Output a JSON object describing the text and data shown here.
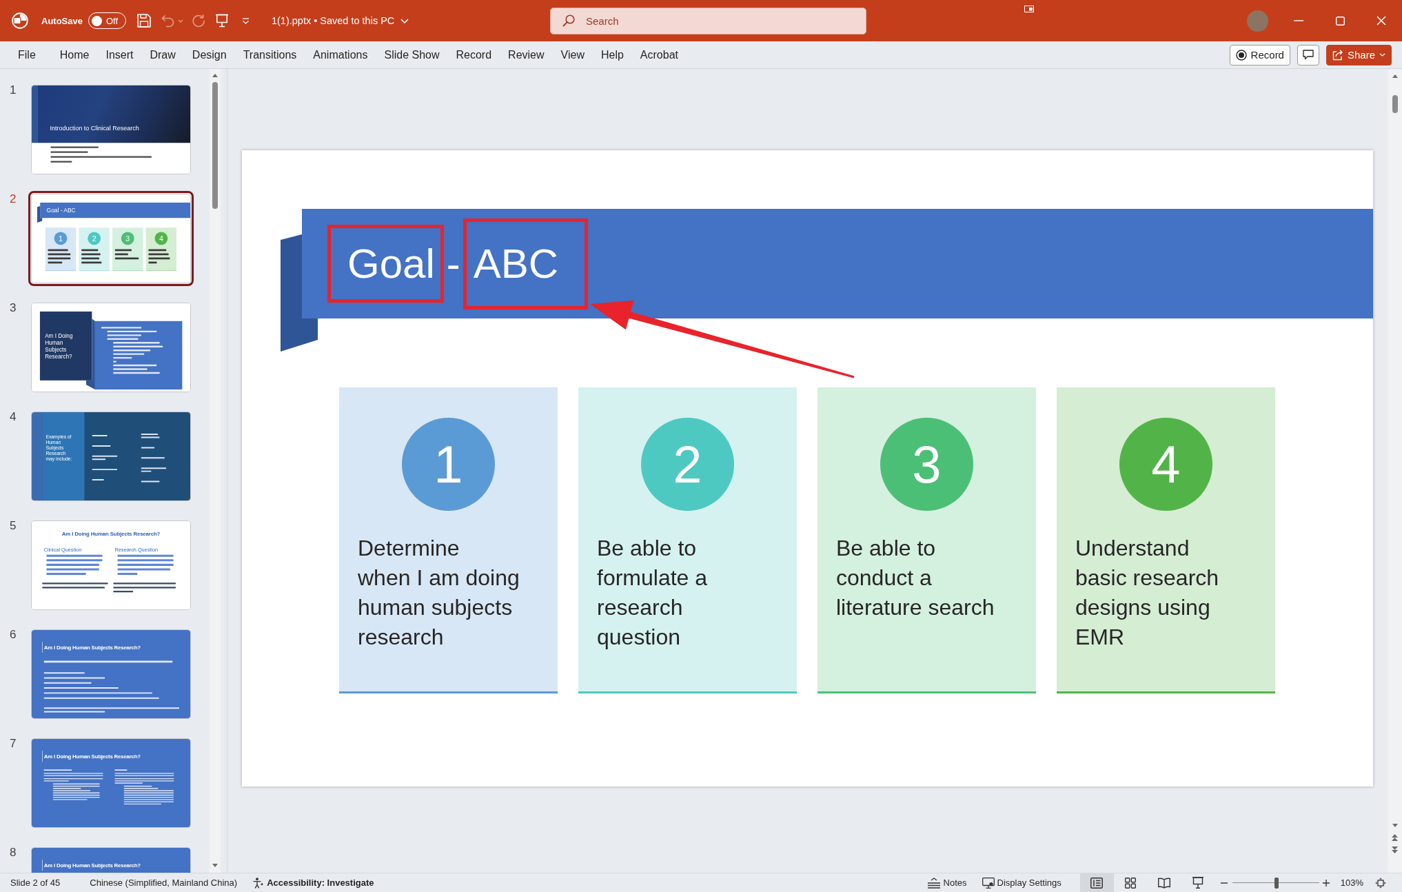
{
  "title_bar": {
    "autosave": {
      "label": "AutoSave",
      "on": false,
      "state_text": "Off"
    },
    "quick_access": [
      {
        "kind": "save",
        "disabled": false
      },
      {
        "kind": "undo",
        "disabled": true
      },
      {
        "kind": "redo",
        "disabled": true
      },
      {
        "kind": "present",
        "disabled": false
      }
    ],
    "document": "1(1).pptx • Saved to this PC",
    "search": {
      "placeholder": "Search"
    }
  },
  "ribbon_tabs": [
    {
      "label": "File",
      "selected": false
    },
    {
      "label": "Home",
      "selected": false
    },
    {
      "label": "Insert",
      "selected": false
    },
    {
      "label": "Draw",
      "selected": false
    },
    {
      "label": "Design",
      "selected": false
    },
    {
      "label": "Transitions",
      "selected": false
    },
    {
      "label": "Animations",
      "selected": false
    },
    {
      "label": "Slide Show",
      "selected": false
    },
    {
      "label": "Record",
      "selected": false
    },
    {
      "label": "Review",
      "selected": false
    },
    {
      "label": "View",
      "selected": false
    },
    {
      "label": "Help",
      "selected": false
    },
    {
      "label": "Acrobat",
      "selected": false
    }
  ],
  "ribbon_actions": {
    "record": "Record",
    "share": "Share"
  },
  "thumbnails": [
    {
      "number": "1",
      "selected": false,
      "slide": {
        "kind": "title",
        "title": "Introduction to Clinical Research"
      }
    },
    {
      "number": "2",
      "selected": true,
      "slide": {
        "kind": "goal",
        "title": "Goal - ABC",
        "cards": [
          {
            "number": "1",
            "color": "#5b9bd5"
          },
          {
            "number": "2",
            "color": "#4ec9c1"
          },
          {
            "number": "3",
            "color": "#4cbf77"
          },
          {
            "number": "4",
            "color": "#52b448"
          }
        ]
      }
    },
    {
      "number": "3",
      "selected": false,
      "slide": {
        "kind": "section",
        "title": "Am I Doing Human Subjects Research?"
      }
    },
    {
      "number": "4",
      "selected": false,
      "slide": {
        "kind": "examples",
        "title": "Examples of Human Subjects Research may include:"
      }
    },
    {
      "number": "5",
      "selected": false,
      "slide": {
        "kind": "two_column",
        "title": "Am I Doing Human Subjects Research?",
        "columns": [
          {
            "heading": "Clinical Question"
          },
          {
            "heading": "Research Question"
          }
        ]
      }
    },
    {
      "number": "6",
      "selected": false,
      "slide": {
        "kind": "list",
        "title": "Am I Doing Human Subjects Research?"
      }
    },
    {
      "number": "7",
      "selected": false,
      "slide": {
        "kind": "comparison",
        "title": "Am I Doing Human Subjects Research?"
      }
    },
    {
      "number": "8",
      "selected": false,
      "slide": {
        "kind": "title_only",
        "title": "Am I Doing Human Subjects Research?"
      }
    }
  ],
  "slide": {
    "title_parts": [
      {
        "text": "Goal",
        "highlighted": true
      },
      {
        "text": "-",
        "highlighted": false
      },
      {
        "text": "ABC",
        "highlighted": true
      }
    ],
    "cards": [
      {
        "number": "1",
        "text": "Determine\nwhen I am doing\nhuman subjects\nresearch",
        "color": "#5b9bd5"
      },
      {
        "number": "2",
        "text": "Be able to\nformulate a\nresearch\nquestion",
        "color": "#4ec9c1"
      },
      {
        "number": "3",
        "text": "Be able to\nconduct a\nliterature search",
        "color": "#4cbf77"
      },
      {
        "number": "4",
        "text": "Understand\nbasic research\ndesigns using\nEMR",
        "color": "#52b448"
      }
    ]
  },
  "status_bar": {
    "slide_info": "Slide 2 of 45",
    "language": "Chinese (Simplified, Mainland China)",
    "accessibility": "Accessibility: Investigate",
    "notes": "Notes",
    "display_settings": "Display Settings",
    "views": [
      {
        "kind": "normal",
        "selected": true
      },
      {
        "kind": "sorter",
        "selected": false
      },
      {
        "kind": "reading",
        "selected": false
      },
      {
        "kind": "slideshow",
        "selected": false
      }
    ],
    "zoom": {
      "level": 0.51,
      "reading": "103%"
    }
  }
}
